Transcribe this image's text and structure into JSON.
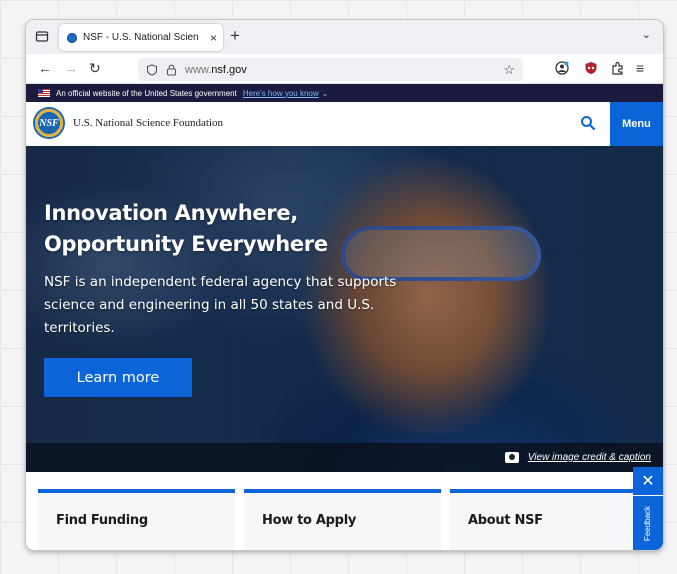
{
  "browser": {
    "tab_title": "NSF - U.S. National Scien",
    "tab_close": "×",
    "new_tab": "+",
    "overflow": "⌄",
    "nav_back": "←",
    "nav_forward": "→",
    "nav_reload": "↻",
    "url_prefix": "www.",
    "url_domain": "nsf.gov",
    "menu_glyph": "≡"
  },
  "gov_banner": {
    "text": "An official website of the United States government",
    "link": "Here's how you know",
    "chevron": "⌄"
  },
  "site_header": {
    "logo_text": "NSF",
    "org_name": "U.S. National Science Foundation",
    "menu_label": "Menu"
  },
  "hero": {
    "title_line1": "Innovation Anywhere,",
    "title_line2": "Opportunity Everywhere",
    "description": "NSF is an independent federal agency that supports science and engineering in all 50 states and U.S. territories.",
    "cta_label": "Learn more",
    "credit_link": "View image credit & caption"
  },
  "cards": [
    {
      "title": "Find Funding"
    },
    {
      "title": "How to Apply"
    },
    {
      "title": "About NSF"
    }
  ],
  "feedback": {
    "close": "✕",
    "label": "Feedback"
  },
  "colors": {
    "accent": "#0b64d8",
    "gov_banner_bg": "#1b1b3f"
  }
}
